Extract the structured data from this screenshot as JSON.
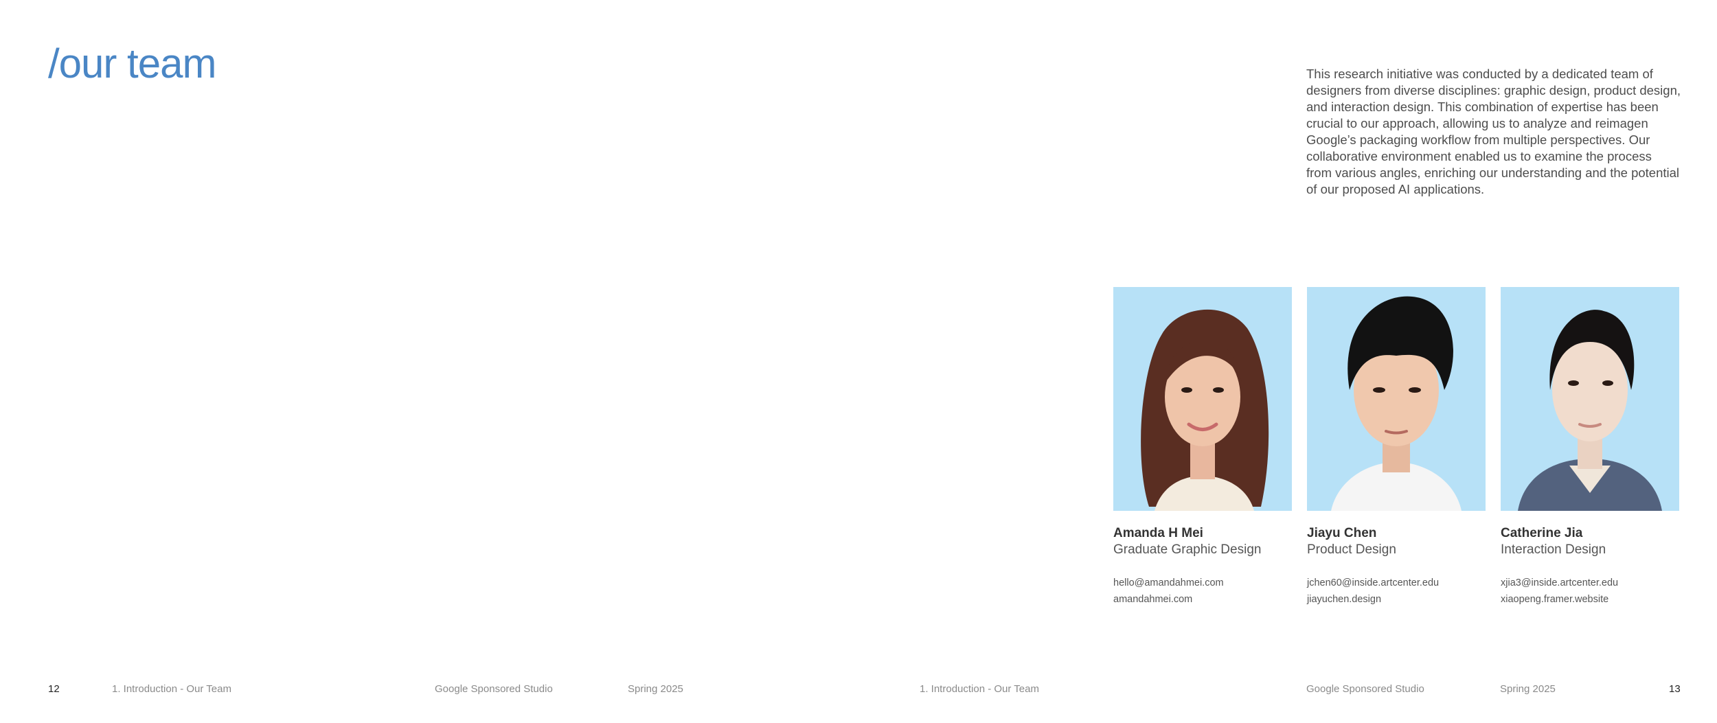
{
  "title": "/our team",
  "intro": "This research initiative was conducted by a dedicated team of designers from diverse disciplines: graphic design, product design, and interaction design. This combination of expertise has been crucial to our approach, allowing us to analyze and reimagen Google’s packaging workflow from multiple perspectives. Our collaborative environment enabled us to examine the process from various angles, enriching our understanding and the potential of our proposed AI applications.",
  "team": [
    {
      "name": "Amanda H Mei",
      "role": "Graduate Graphic Design",
      "email": "hello@amandahmei.com",
      "website": "amandahmei.com"
    },
    {
      "name": "Jiayu Chen",
      "role": "Product Design",
      "email": "jchen60@inside.artcenter.edu",
      "website": "jiayuchen.design"
    },
    {
      "name": "Catherine Jia",
      "role": "Interaction Design",
      "email": "xjia3@inside.artcenter.edu",
      "website": "xiaopeng.framer.website"
    }
  ],
  "footer": {
    "left": {
      "page": "12",
      "section": "1. Introduction - Our Team",
      "studio": "Google Sponsored Studio",
      "term": "Spring 2025"
    },
    "right": {
      "section": "1. Introduction - Our Team",
      "studio": "Google Sponsored Studio",
      "term": "Spring 2025",
      "page": "13"
    }
  },
  "colors": {
    "title": "#4a86c5",
    "photo_background": "#b7e1f7"
  }
}
